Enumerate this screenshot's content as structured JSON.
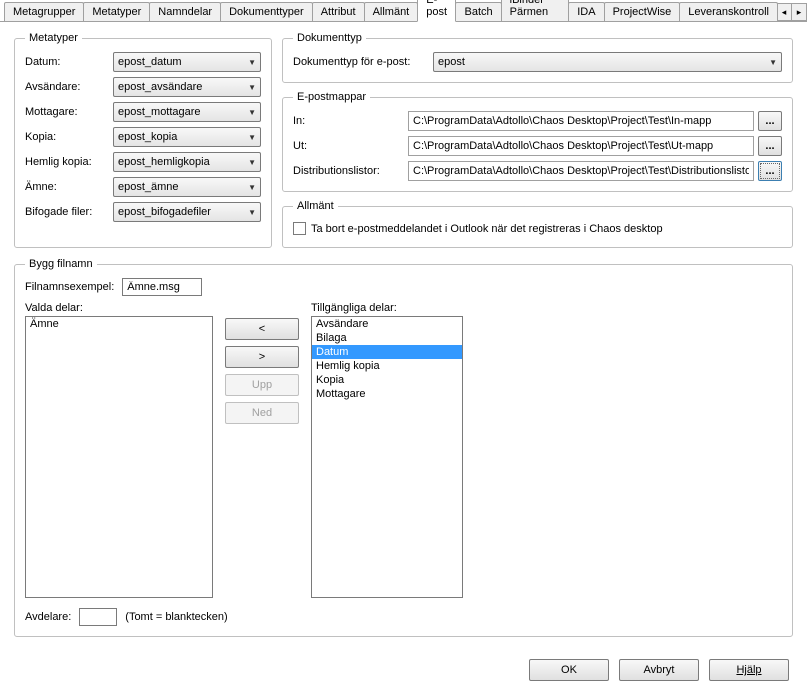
{
  "tabs": [
    "Metagrupper",
    "Metatyper",
    "Namndelar",
    "Dokumenttyper",
    "Attribut",
    "Allmänt",
    "E-post",
    "Batch",
    "iBinder Pärmen",
    "IDA",
    "ProjectWise",
    "Leveranskontroll"
  ],
  "activeTab": "E-post",
  "scroll": {
    "left": "◄",
    "right": "►"
  },
  "metatyper": {
    "legend": "Metatyper",
    "rows": [
      {
        "label": "Datum:",
        "value": "epost_datum"
      },
      {
        "label": "Avsändare:",
        "value": "epost_avsändare"
      },
      {
        "label": "Mottagare:",
        "value": "epost_mottagare"
      },
      {
        "label": "Kopia:",
        "value": "epost_kopia"
      },
      {
        "label": "Hemlig kopia:",
        "value": "epost_hemligkopia"
      },
      {
        "label": "Ämne:",
        "value": "epost_ämne"
      },
      {
        "label": "Bifogade filer:",
        "value": "epost_bifogadefiler"
      }
    ]
  },
  "dokumenttyp": {
    "legend": "Dokumenttyp",
    "label": "Dokumenttyp för e-post:",
    "value": "epost"
  },
  "epostmappar": {
    "legend": "E-postmappar",
    "rows": [
      {
        "label": "In:",
        "value": "C:\\ProgramData\\Adtollo\\Chaos Desktop\\Project\\Test\\In-mapp"
      },
      {
        "label": "Ut:",
        "value": "C:\\ProgramData\\Adtollo\\Chaos Desktop\\Project\\Test\\Ut-mapp"
      },
      {
        "label": "Distributionslistor:",
        "value": "C:\\ProgramData\\Adtollo\\Chaos Desktop\\Project\\Test\\Distributionslistor"
      }
    ],
    "browse": "..."
  },
  "allmant": {
    "legend": "Allmänt",
    "checkbox": "Ta bort e-postmeddelandet i Outlook när det registreras i Chaos desktop"
  },
  "bygg": {
    "legend": "Bygg filnamn",
    "filexLabel": "Filnamnsexempel:",
    "filexValue": "Ämne.msg",
    "valdaLabel": "Valda delar:",
    "tillgLabel": "Tillgängliga delar:",
    "valda": [
      "Ämne"
    ],
    "tillg": [
      "Avsändare",
      "Bilaga",
      "Datum",
      "Hemlig kopia",
      "Kopia",
      "Mottagare"
    ],
    "selected": "Datum",
    "btns": {
      "lt": "<",
      "gt": ">",
      "upp": "Upp",
      "ned": "Ned"
    },
    "avdelareLabel": "Avdelare:",
    "avdelareHint": "(Tomt = blanktecken)"
  },
  "dialog": {
    "ok": "OK",
    "avbryt": "Avbryt",
    "hjalp": "Hjälp"
  }
}
